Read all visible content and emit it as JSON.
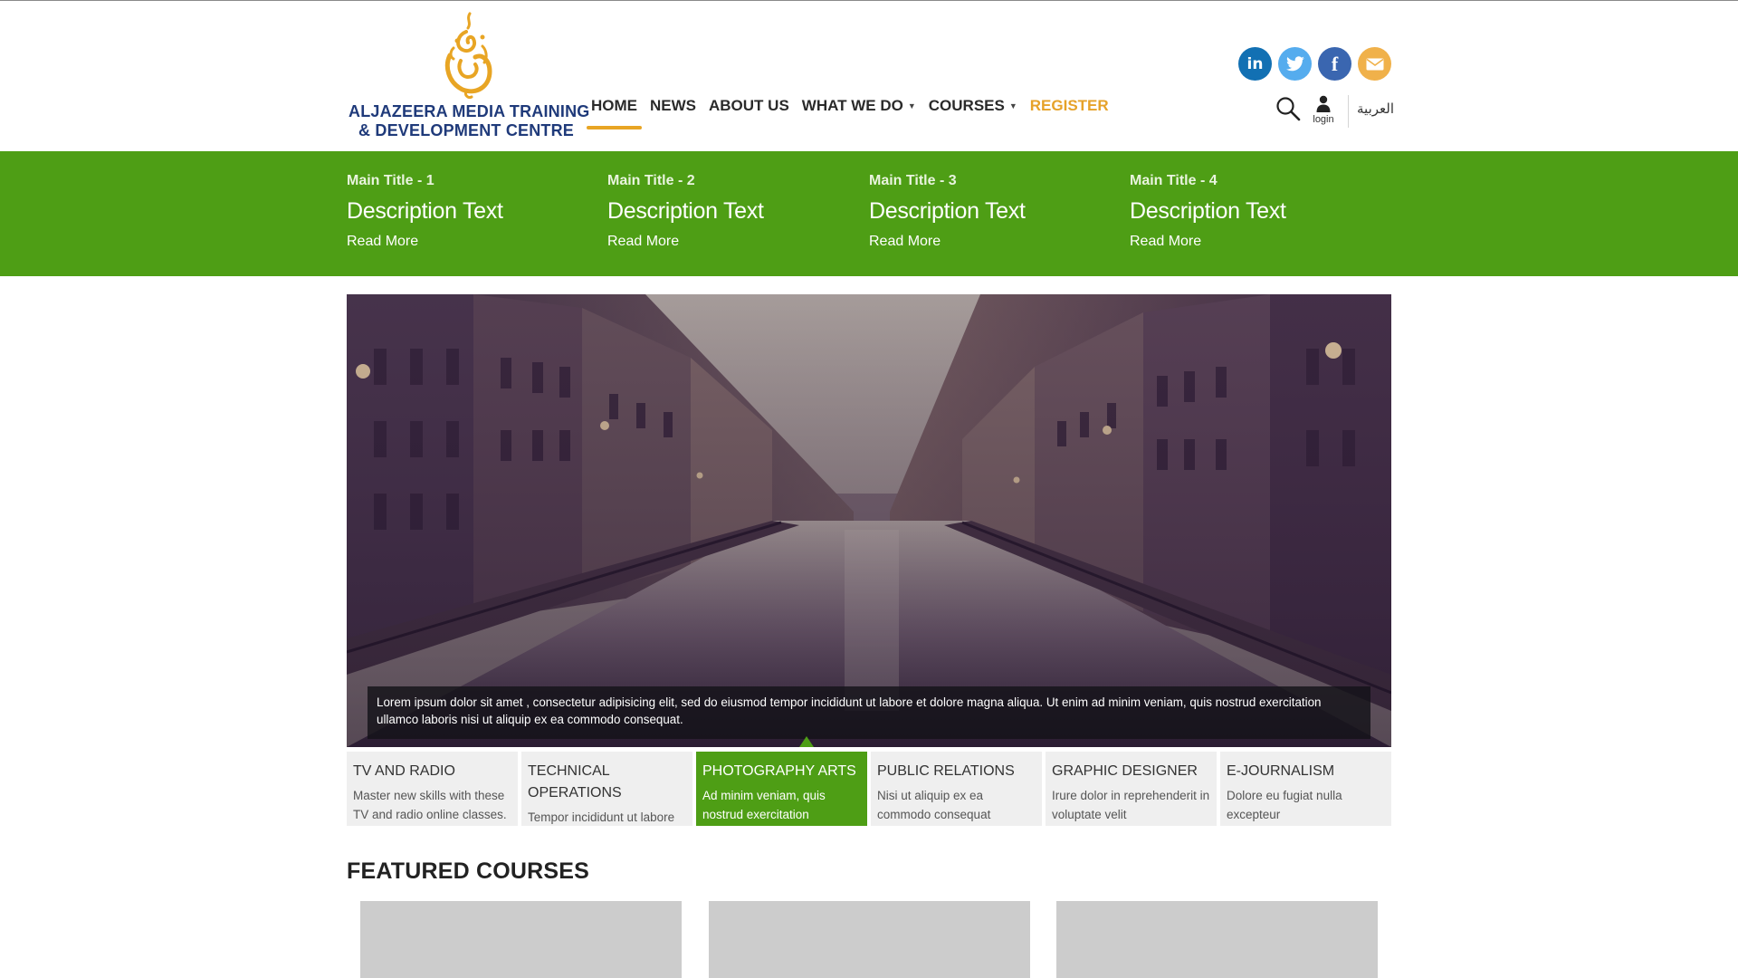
{
  "colors": {
    "brand_green": "#4e9e15",
    "accent_gold": "#e8a524",
    "logo_navy": "#1f3a7a"
  },
  "logo": {
    "line1": "ALJAZEERA MEDIA TRAINING",
    "line2": "& DEVELOPMENT CENTRE",
    "icon": "aljazeera-calligraphy-logo"
  },
  "nav": {
    "home": "HOME",
    "news": "NEWS",
    "about": "ABOUT US",
    "what_we_do": "WHAT WE DO",
    "courses": "COURSES",
    "register": "REGISTER",
    "active": "HOME"
  },
  "socials": {
    "linkedin": "in",
    "twitter": "twitter-icon",
    "facebook": "f",
    "email": "email-icon"
  },
  "tools": {
    "search_icon": "search-icon",
    "login_label": "login",
    "language": "العربية"
  },
  "band": [
    {
      "title": "Main Title - 1",
      "desc": "Description Text",
      "more": "Read More"
    },
    {
      "title": "Main Title - 2",
      "desc": "Description Text",
      "more": "Read More"
    },
    {
      "title": "Main Title - 3",
      "desc": "Description Text",
      "more": "Read More"
    },
    {
      "title": "Main Title - 4",
      "desc": "Description Text",
      "more": "Read More"
    }
  ],
  "hero": {
    "caption": "Lorem ipsum dolor sit amet , consectetur adipisicing elit, sed do eiusmod tempor incididunt ut labore et dolore magna aliqua. Ut enim ad minim veniam, quis nostrud exercitation ullamco laboris nisi ut aliquip ex ea commodo consequat."
  },
  "tabs": [
    {
      "title": "TV AND RADIO",
      "desc": "Master new skills with these TV and radio online classes."
    },
    {
      "title": "TECHNICAL OPERATIONS",
      "desc": "Tempor incididunt ut labore et"
    },
    {
      "title": "PHOTOGRAPHY ARTS",
      "desc": "Ad minim veniam, quis nostrud exercitation"
    },
    {
      "title": "PUBLIC RELATIONS",
      "desc": "Nisi ut aliquip ex ea commodo consequat"
    },
    {
      "title": "GRAPHIC DESIGNER",
      "desc": "Irure dolor in reprehenderit in voluptate velit"
    },
    {
      "title": "E-JOURNALISM",
      "desc": "Dolore eu fugiat nulla excepteur"
    }
  ],
  "active_tab": "PHOTOGRAPHY ARTS",
  "featured": {
    "title": "FEATURED COURSES"
  }
}
